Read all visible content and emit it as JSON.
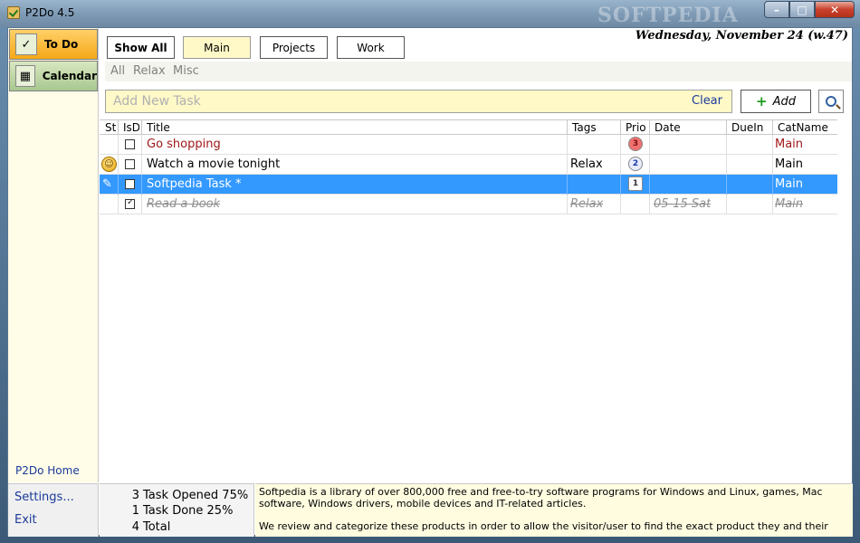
{
  "window": {
    "title": "P2Do 4.5",
    "watermark": "SOFTPEDIA",
    "controls": {
      "minimize": "–",
      "maximize": "□",
      "close": "✕"
    }
  },
  "sidebar": {
    "items": [
      {
        "label": "To Do",
        "icon": "clipboard-icon"
      },
      {
        "label": "Calendar",
        "icon": "calendar-icon"
      }
    ],
    "home_link": "P2Do Home",
    "settings_link": "Settings...",
    "exit_link": "Exit"
  },
  "header": {
    "date": "Wednesday, November 24 (w.47)",
    "filters": [
      "Show All",
      "Main",
      "Projects",
      "Work"
    ],
    "active_filter": "Main",
    "subcategories": [
      "All",
      "Relax",
      "Misc"
    ]
  },
  "newtask": {
    "placeholder": "Add New Task",
    "clear_label": "Clear",
    "add_label": "Add"
  },
  "table": {
    "columns": [
      "St",
      "IsD",
      "Title",
      "Tags",
      "Prio",
      "Date",
      "DueIn",
      "CatName"
    ],
    "rows": [
      {
        "status_icon": "",
        "done": false,
        "title": "Go shopping",
        "tags": "",
        "prio": "3",
        "date": "",
        "duein": "",
        "cat": "Main"
      },
      {
        "status_icon": "smiley-icon",
        "done": false,
        "title": "Watch a movie tonight",
        "tags": "Relax",
        "prio": "2",
        "date": "",
        "duein": "",
        "cat": "Main"
      },
      {
        "status_icon": "wand-icon",
        "done": false,
        "title": "Softpedia Task *",
        "tags": "",
        "prio": "1",
        "date": "",
        "duein": "",
        "cat": "Main"
      },
      {
        "status_icon": "",
        "done": true,
        "title": "Read a book",
        "tags": "Relax",
        "prio": "",
        "date": "05-15 Sat",
        "duein": "",
        "cat": "Main"
      }
    ]
  },
  "stats": {
    "opened": {
      "count": "3",
      "label": "Task Opened 75%"
    },
    "done": {
      "count": "1",
      "label": "Task Done 25%"
    },
    "total": {
      "count": "4",
      "label": "Total"
    }
  },
  "about": {
    "p1": "Softpedia is a library of over 800,000 free and free-to-try software programs for Windows and Linux, games, Mac software, Windows drivers, mobile devices and IT-related articles.",
    "p2": "We review and categorize these products in order to allow the visitor/user to find the exact product they and their"
  }
}
